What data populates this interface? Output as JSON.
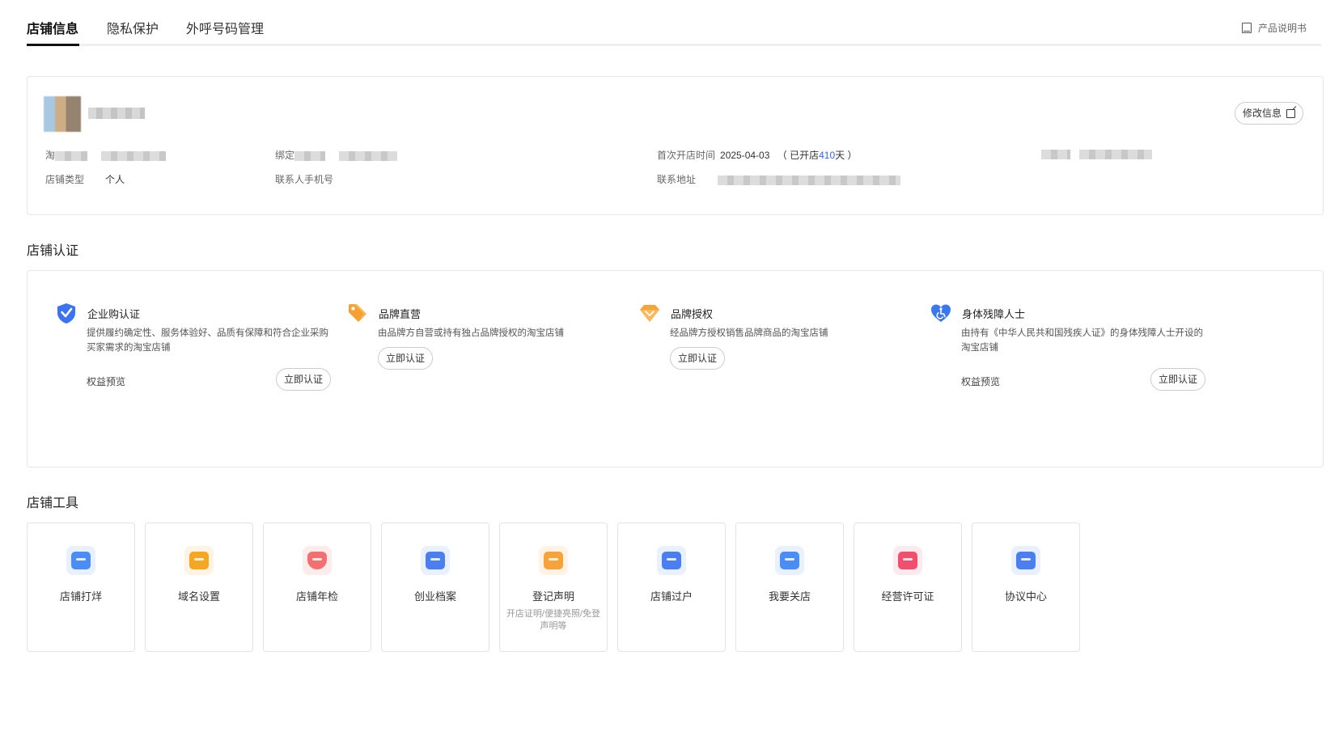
{
  "tabs": [
    {
      "label": "店铺信息",
      "active": true
    },
    {
      "label": "隐私保护",
      "active": false
    },
    {
      "label": "外呼号码管理",
      "active": false
    }
  ],
  "manual_link": "产品说明书",
  "shop_info": {
    "edit_button": "修改信息",
    "taobao_prefix": "淘",
    "bind_prefix": "绑定",
    "first_open_label": "首次开店时间",
    "first_open_date": "2025-04-03",
    "open_days_prefix": "（ 已开店",
    "open_days": "410",
    "open_days_suffix": "天 ）",
    "shop_type_label": "店铺类型",
    "shop_type_value": "个人",
    "contact_phone_label": "联系人手机号",
    "address_label": "联系地址"
  },
  "cert_section_title": "店铺认证",
  "certifications": [
    {
      "title": "企业购认证",
      "desc": "提供履约确定性、服务体验好、品质有保障和符合企业采购买家需求的淘宝店铺",
      "rights": "权益预览",
      "button": "立即认证",
      "icon": "shield-check-icon",
      "color": "#3b73f5"
    },
    {
      "title": "品牌直营",
      "desc": "由品牌方自营或持有独占品牌授权的淘宝店铺",
      "rights": "",
      "button": "立即认证",
      "icon": "tag-icon",
      "color": "#f5a030"
    },
    {
      "title": "品牌授权",
      "desc": "经品牌方授权销售品牌商品的淘宝店铺",
      "rights": "",
      "button": "立即认证",
      "icon": "gem-icon",
      "color": "#f7a43a"
    },
    {
      "title": "身体残障人士",
      "desc": "由持有《中华人民共和国残疾人证》的身体残障人士开设的淘宝店铺",
      "rights": "权益预览",
      "button": "立即认证",
      "icon": "heart-accessibility-icon",
      "color": "#3a78f0"
    }
  ],
  "tools_section_title": "店铺工具",
  "tools": [
    {
      "label": "店铺打烊",
      "sub": "",
      "icon": "shop-closed-icon",
      "color": "#4b8cf5",
      "bg": "#e9f1fe"
    },
    {
      "label": "域名设置",
      "sub": "",
      "icon": "domain-icon",
      "color": "#f5a623",
      "bg": "#fff3e3"
    },
    {
      "label": "店铺年检",
      "sub": "",
      "icon": "inspection-shield-icon",
      "color": "#f2706f",
      "bg": "#fdecec"
    },
    {
      "label": "创业档案",
      "sub": "",
      "icon": "archive-icon",
      "color": "#4b7ff0",
      "bg": "#e9f0fe"
    },
    {
      "label": "登记声明",
      "sub": "开店证明/便捷亮照/免登声明等",
      "icon": "register-doc-icon",
      "color": "#f7a33b",
      "bg": "#fff3e3"
    },
    {
      "label": "店铺过户",
      "sub": "",
      "icon": "transfer-icon",
      "color": "#4b7ff0",
      "bg": "#e9f0fe"
    },
    {
      "label": "我要关店",
      "sub": "",
      "icon": "close-shop-icon",
      "color": "#4b8cf5",
      "bg": "#e9f1fe"
    },
    {
      "label": "经营许可证",
      "sub": "",
      "icon": "license-folder-icon",
      "color": "#f0506e",
      "bg": "#fdeaee"
    },
    {
      "label": "协议中心",
      "sub": "",
      "icon": "agreement-icon",
      "color": "#4b7ff0",
      "bg": "#e9f0fe"
    }
  ]
}
